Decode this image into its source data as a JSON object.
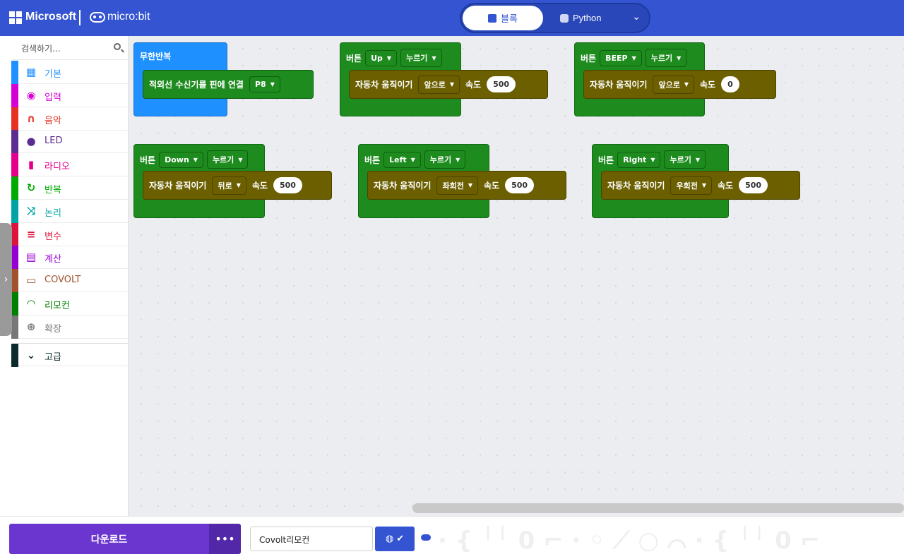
{
  "header": {
    "brand": "Microsoft",
    "product": "micro:bit",
    "tabs": [
      {
        "label": "블록",
        "icon": "puzzle-icon",
        "active": true
      },
      {
        "label": "Python",
        "icon": "python-icon",
        "active": false
      }
    ]
  },
  "sidebar": {
    "search_placeholder": "검색하기...",
    "categories": [
      {
        "label": "기본",
        "color": "#1e90ff",
        "icon": "grid-icon",
        "glyph": "▦"
      },
      {
        "label": "입력",
        "color": "#d400d4",
        "icon": "circle-dot-icon",
        "glyph": "◉"
      },
      {
        "label": "음악",
        "color": "#e63022",
        "icon": "headphones-icon",
        "glyph": "∩"
      },
      {
        "label": "LED",
        "color": "#5c2d91",
        "icon": "toggle-icon",
        "glyph": "●"
      },
      {
        "label": "라디오",
        "color": "#e3008c",
        "icon": "signal-bars-icon",
        "glyph": "▮"
      },
      {
        "label": "반복",
        "color": "#00aa00",
        "icon": "refresh-icon",
        "glyph": "↻"
      },
      {
        "label": "논리",
        "color": "#00a4a6",
        "icon": "shuffle-icon",
        "glyph": "⤨"
      },
      {
        "label": "변수",
        "color": "#dc143c",
        "icon": "list-icon",
        "glyph": "≡"
      },
      {
        "label": "계산",
        "color": "#9400d3",
        "icon": "calculator-icon",
        "glyph": "▤"
      },
      {
        "label": "COVOLT",
        "color": "#a0522d",
        "icon": "car-icon",
        "glyph": "▭"
      },
      {
        "label": "리모컨",
        "color": "#008000",
        "icon": "wifi-icon",
        "glyph": "◠"
      },
      {
        "label": "확장",
        "color": "#777777",
        "icon": "plus-circle-icon",
        "glyph": "⊕"
      }
    ],
    "advanced": {
      "label": "고급",
      "color": "#0b2a2a",
      "icon": "chevron-down-icon",
      "glyph": "⌄"
    }
  },
  "blocks": {
    "forever": {
      "title": "무한반복",
      "stmt": "적외선 수신기를 핀에 연결",
      "pin": "P8"
    },
    "events": [
      {
        "label": "버튼",
        "button": "Up",
        "action": "누르기",
        "stmt": "자동차 움직이기",
        "dir": "앞으로",
        "speed_label": "속도",
        "speed": "500"
      },
      {
        "label": "버튼",
        "button": "BEEP",
        "action": "누르기",
        "stmt": "자동차 움직이기",
        "dir": "앞으로",
        "speed_label": "속도",
        "speed": "0"
      },
      {
        "label": "버튼",
        "button": "Down",
        "action": "누르기",
        "stmt": "자동차 움직이기",
        "dir": "뒤로",
        "speed_label": "속도",
        "speed": "500"
      },
      {
        "label": "버튼",
        "button": "Left",
        "action": "누르기",
        "stmt": "자동차 움직이기",
        "dir": "좌회전",
        "speed_label": "속도",
        "speed": "500"
      },
      {
        "label": "버튼",
        "button": "Right",
        "action": "누르기",
        "stmt": "자동차 움직이기",
        "dir": "우회전",
        "speed_label": "속도",
        "speed": "500"
      }
    ]
  },
  "footer": {
    "download_label": "다운로드",
    "more_label": "•••",
    "project_name": "Covolt리모컨"
  },
  "colors": {
    "header": "#3454d1",
    "download": "#6b35d0",
    "event_block": "#1e8b1e",
    "forever_block": "#1e90ff",
    "car_block": "#6b5f00"
  }
}
